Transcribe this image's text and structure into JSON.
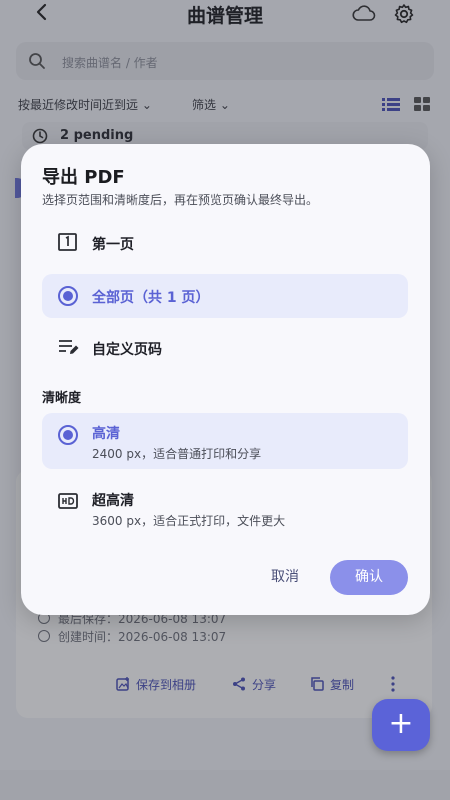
{
  "appbar": {
    "title": "曲谱管理",
    "back_icon": "chevron-left-icon",
    "cloud_icon": "cloud-icon",
    "settings_icon": "gear-icon"
  },
  "search": {
    "placeholder": "搜索曲谱名 / 作者",
    "icon": "search-icon"
  },
  "sortbar": {
    "sort_label": "按最近修改时间近到远",
    "filter_label": "筛选",
    "view_list_icon": "list-view-icon",
    "view_grid_icon": "grid-view-icon"
  },
  "pending": {
    "label": "2 pending",
    "icon": "clock-icon"
  },
  "card": {
    "last_saved": "最后保存：2026-06-08 13:07",
    "created": "创建时间：2026-06-08 13:07",
    "actions": [
      {
        "label": "保存到相册",
        "icon": "save-image-icon"
      },
      {
        "label": "分享",
        "icon": "share-icon"
      },
      {
        "label": "复制",
        "icon": "copy-icon"
      }
    ],
    "more_icon": "more-vertical-icon"
  },
  "fab": {
    "icon": "plus-icon"
  },
  "dialog": {
    "title": "导出 PDF",
    "subtitle": "选择页范围和清晰度后，再在预览页确认最终导出。",
    "page_options": [
      {
        "label": "第一页",
        "icon": "page-one-icon",
        "selected": false
      },
      {
        "label": "全部页（共 1 页）",
        "icon": "radio-selected-icon",
        "selected": true
      },
      {
        "label": "自定义页码",
        "icon": "edit-list-icon",
        "selected": false
      }
    ],
    "quality_heading": "清晰度",
    "quality_options": [
      {
        "label": "高清",
        "desc": "2400 px，适合普通打印和分享",
        "icon": "radio-selected-icon",
        "selected": true
      },
      {
        "label": "超高清",
        "desc": "3600 px，适合正式打印，文件更大",
        "icon": "hd-icon",
        "selected": false
      }
    ],
    "cancel_label": "取消",
    "confirm_label": "确认",
    "accent_color": "#5a62d4",
    "confirm_color": "#8b90ea"
  }
}
